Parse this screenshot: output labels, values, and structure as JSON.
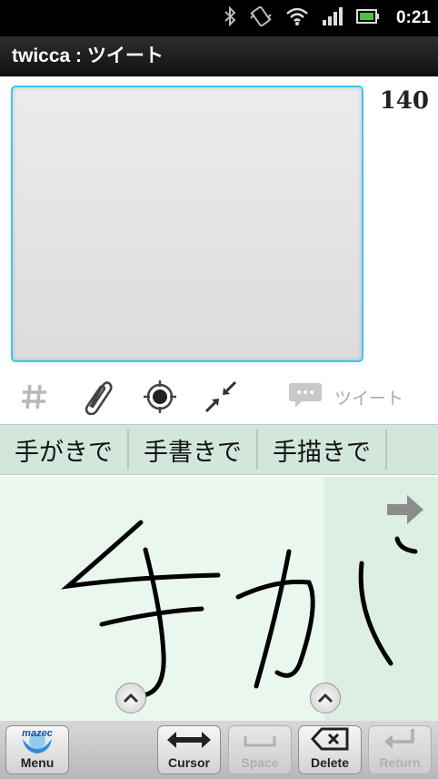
{
  "statusbar": {
    "time": "0:21",
    "icons": [
      "bluetooth-icon",
      "vibrate-icon",
      "wifi-icon",
      "signal-icon",
      "battery-icon"
    ]
  },
  "titlebar": {
    "title": "twicca : ツイート"
  },
  "compose": {
    "text": "",
    "remaining_count": "140"
  },
  "toolbar": {
    "items": [
      "hashtag-icon",
      "attachment-icon",
      "location-icon",
      "shrink-icon"
    ],
    "tweet_label": "ツイート"
  },
  "candidates": [
    "手がきで",
    "手書きで",
    "手描きで"
  ],
  "handwriting": {
    "strokes_text": "手が"
  },
  "keyboard": {
    "menu_logo": "mazec",
    "menu_label": "Menu",
    "cursor_label": "Cursor",
    "space_label": "Space",
    "delete_label": "Delete",
    "return_label": "Return"
  },
  "colors": {
    "accent_border": "#37c8f0",
    "candidate_bar": "#d2e6dc",
    "canvas_bg": "#eaf7ee"
  }
}
